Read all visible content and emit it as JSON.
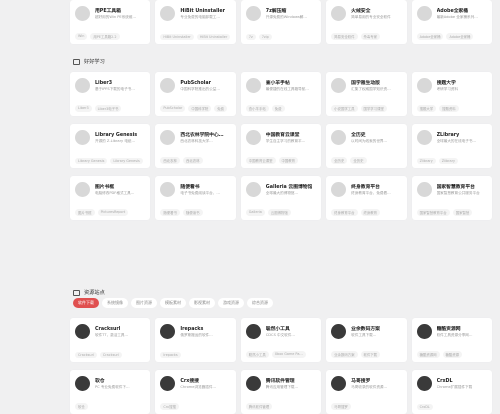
{
  "row_top": [
    {
      "name": "用PE工具箱",
      "desc": "超好用的Win PE系统维…",
      "tags": [
        "Win",
        "用PE工具箱2.2"
      ],
      "dark": false
    },
    {
      "name": "HiBit Uninstaller",
      "desc": "专业免费的电脑卸载工…",
      "tags": [
        "HiBit Uninstaller",
        "HiBit Uninstaller"
      ],
      "dark": false
    },
    {
      "name": "7z解压缩",
      "desc": "开源免费的Windows解…",
      "tags": [
        "7z",
        "7zip"
      ],
      "dark": false
    },
    {
      "name": "火绒安全",
      "desc": "简单易用的专业安全软件",
      "tags": [
        "简易安全软件",
        "杀毒专家"
      ],
      "dark": false
    },
    {
      "name": "Adobe全家桶",
      "desc": "最新Adobe 全家桶系列…",
      "tags": [
        "Adobe全家桶",
        "Adobe全家桶"
      ],
      "dark": false
    }
  ],
  "sections": {
    "study": {
      "title": "好好学习"
    },
    "resources": {
      "title": "资源站点"
    }
  },
  "study_cards": [
    {
      "name": "Liber3",
      "desc": "基于IPFS下载的电子书…",
      "tags": [
        "Liber3",
        "Liber3电子书"
      ],
      "dark": false
    },
    {
      "name": "PubScholar",
      "desc": "中国科学院推出的公益…",
      "tags": [
        "PubScholar",
        "中国科学院",
        "免费"
      ],
      "dark": false
    },
    {
      "name": "查小羊手帖",
      "desc": "最便捷的在线工具箱导航…",
      "tags": [
        "查小羊手帖",
        "免费"
      ],
      "dark": false
    },
    {
      "name": "国学雅生动版",
      "desc": "汇集了权威国学知识资…",
      "tags": [
        "小说国学工具",
        "国学学习课堂"
      ],
      "dark": false
    },
    {
      "name": "搜题大学",
      "desc": "考研学习资料",
      "tags": [
        "搜题大学",
        "搜题资料"
      ],
      "dark": false
    },
    {
      "name": "Library Genesis",
      "desc": "开源的 Z-Library 电纸…",
      "tags": [
        "Library Genesis",
        "Library Genesis"
      ],
      "dark": false
    },
    {
      "name": "西北农林学院中心…",
      "desc": "西北农林科技大学…",
      "tags": [
        "西北农林",
        "西北农林"
      ],
      "dark": false
    },
    {
      "name": "中国教育云课堂",
      "desc": "学生自主学习的教育平…",
      "tags": [
        "中国教育云课堂",
        "中国教育"
      ],
      "dark": false
    },
    {
      "name": "全历史",
      "desc": "以时间为线索的世界…",
      "tags": [
        "全历史",
        "全历史"
      ],
      "dark": false
    },
    {
      "name": "ZLibrary",
      "desc": "全球最大的在线电子书…",
      "tags": [
        "Zlibrary",
        "Zlibrary"
      ],
      "dark": false
    },
    {
      "name": "图片书框",
      "desc": "电脑修改PDF格式工具…",
      "tags": [
        "图片书框",
        "PicturesReport"
      ],
      "dark": false
    },
    {
      "name": "随便看书",
      "desc": "电子书免费阅读平台，…",
      "tags": [
        "随便看书",
        "随便读书"
      ],
      "dark": false
    },
    {
      "name": "Galleria 云图博物馆",
      "desc": "全球最大的博物馆…",
      "tags": [
        "Galleria",
        "云图博物馆"
      ],
      "dark": false
    },
    {
      "name": "终身教育平台",
      "desc": "终身教育平台，免费看…",
      "tags": [
        "终身教育平台",
        "终身教育"
      ],
      "dark": false
    },
    {
      "name": "国家智慧教育平台",
      "desc": "国家智慧教育公共服务平台",
      "tags": [
        "国家智慧教育平台",
        "国家智慧"
      ],
      "dark": false
    }
  ],
  "tabs": [
    "软件下载",
    "系统镜像",
    "图片资源",
    "模板素材",
    "影视素材",
    "游戏资源",
    "综合资源"
  ],
  "resource_cards": [
    {
      "name": "Cracksurl",
      "desc": "软件TT，激活工具…",
      "tags": [
        "Cracksurl",
        "Cracksurl"
      ],
      "dark": true
    },
    {
      "name": "Irepacks",
      "desc": "俄罗斯搬运的软件…",
      "tags": [
        "Irepacks"
      ],
      "dark": true
    },
    {
      "name": "聪然小工具",
      "desc": "CDCS 中文软件…",
      "tags": [
        "聪然小工具",
        "Xbox Game Pa…"
      ],
      "dark": true
    },
    {
      "name": "业余数码方案",
      "desc": "软件工具下载…",
      "tags": [
        "业余数码方案",
        "软件下载"
      ],
      "dark": true
    },
    {
      "name": "糖酷资源网",
      "desc": "软件工具资源分享网…",
      "tags": [
        "糖酷资源网",
        "糖酷资源"
      ],
      "dark": true
    },
    {
      "name": "软仓",
      "desc": "PC 专业免费软件下…",
      "tags": [
        "软仓"
      ],
      "dark": true
    },
    {
      "name": "Crx搜搜",
      "desc": "Chrome浏览器插件…",
      "tags": [
        "Crx搜搜"
      ],
      "dark": true
    },
    {
      "name": "腾讯软件管理",
      "desc": "腾讯应用管理下载…",
      "tags": [
        "腾讯软件管理"
      ],
      "dark": true
    },
    {
      "name": "马哥搜罗",
      "desc": "马哥收录的软件资源…",
      "tags": [
        "马哥搜罗"
      ],
      "dark": true
    },
    {
      "name": "CrxDL",
      "desc": "Chrome扩展插件下载",
      "tags": [
        "CrxDL"
      ],
      "dark": true
    }
  ]
}
